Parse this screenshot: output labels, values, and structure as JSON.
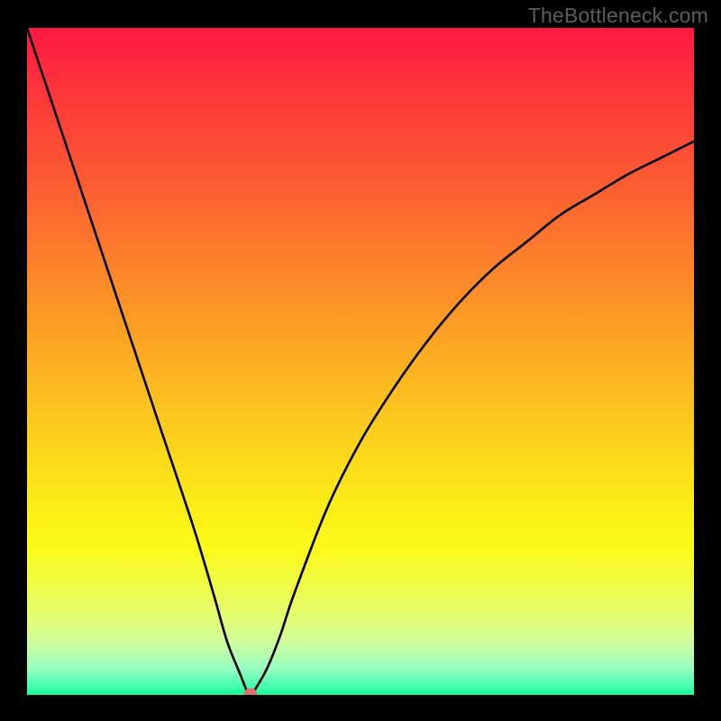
{
  "watermark": "TheBottleneck.com",
  "chart_data": {
    "type": "line",
    "title": "",
    "xlabel": "",
    "ylabel": "",
    "xlim": [
      0,
      100
    ],
    "ylim": [
      0,
      100
    ],
    "grid": false,
    "legend": false,
    "series": [
      {
        "name": "bottleneck-curve",
        "x": [
          0,
          5,
          10,
          15,
          20,
          25,
          28,
          30,
          32,
          33,
          33.5,
          34,
          36,
          38,
          40,
          45,
          50,
          55,
          60,
          65,
          70,
          75,
          80,
          85,
          90,
          95,
          100
        ],
        "y": [
          100,
          85,
          70,
          55,
          40,
          25,
          15,
          8,
          3,
          0.5,
          0,
          0.5,
          4,
          9,
          15,
          28,
          38,
          46,
          53,
          59,
          64,
          68,
          72,
          75,
          78,
          80.5,
          83
        ]
      }
    ],
    "marker": {
      "x": 33.5,
      "y": 0,
      "color": "#e4716a"
    },
    "background_gradient": {
      "stops": [
        {
          "offset": 0.0,
          "color": "#fd1942"
        },
        {
          "offset": 0.11,
          "color": "#fd3a3a"
        },
        {
          "offset": 0.23,
          "color": "#fc5b32"
        },
        {
          "offset": 0.35,
          "color": "#fc802b"
        },
        {
          "offset": 0.47,
          "color": "#fca524"
        },
        {
          "offset": 0.59,
          "color": "#fcc91e"
        },
        {
          "offset": 0.71,
          "color": "#fceb18"
        },
        {
          "offset": 0.78,
          "color": "#fbfa1a"
        },
        {
          "offset": 0.83,
          "color": "#f1fb42"
        },
        {
          "offset": 0.88,
          "color": "#e5fc6e"
        },
        {
          "offset": 0.92,
          "color": "#cffd9b"
        },
        {
          "offset": 0.96,
          "color": "#9afdc0"
        },
        {
          "offset": 0.985,
          "color": "#4cfcb1"
        },
        {
          "offset": 1.0,
          "color": "#15fc98"
        }
      ]
    }
  }
}
